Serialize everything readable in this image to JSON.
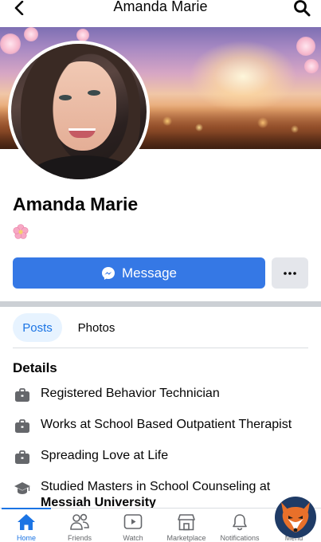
{
  "header": {
    "title": "Amanda Marie",
    "back_icon": "chevron-left-icon",
    "search_icon": "search-icon"
  },
  "profile": {
    "name": "Amanda Marie",
    "emoji": "cherry-blossom"
  },
  "actions": {
    "message_label": "Message",
    "more_label": "•••"
  },
  "tabs": [
    {
      "label": "Posts",
      "active": true
    },
    {
      "label": "Photos",
      "active": false
    }
  ],
  "details": {
    "title": "Details",
    "items": [
      {
        "icon": "briefcase-icon",
        "text": "Registered Behavior Technician"
      },
      {
        "icon": "briefcase-icon",
        "text": "Works at School Based Outpatient Therapist"
      },
      {
        "icon": "briefcase-icon",
        "text": "Spreading Love at Life"
      },
      {
        "icon": "graduation-cap-icon",
        "text": "Studied Masters in School Counseling at",
        "bold_text": "Messiah University"
      }
    ]
  },
  "bottom_nav": [
    {
      "label": "Home",
      "icon": "home-icon",
      "active": true
    },
    {
      "label": "Friends",
      "icon": "friends-icon",
      "active": false
    },
    {
      "label": "Watch",
      "icon": "watch-icon",
      "active": false
    },
    {
      "label": "Marketplace",
      "icon": "marketplace-icon",
      "active": false
    },
    {
      "label": "Notifications",
      "icon": "bell-icon",
      "active": false
    },
    {
      "label": "Menu",
      "icon": "menu-icon",
      "active": false
    }
  ],
  "colors": {
    "accent": "#1b74e4",
    "message_button": "#3578e5",
    "tab_active_bg": "#e7f3ff",
    "separator": "#ccd0d5"
  }
}
